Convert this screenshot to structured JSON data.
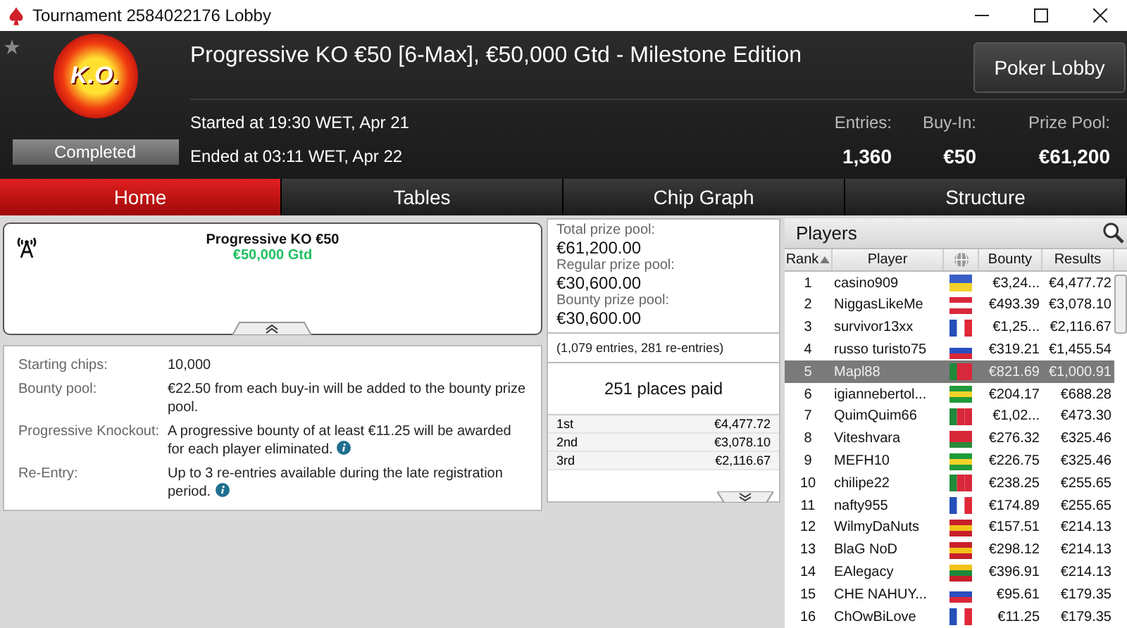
{
  "window": {
    "title": "Tournament 2584022176 Lobby"
  },
  "header": {
    "title": "Progressive KO €50 [6-Max], €50,000 Gtd - Milestone Edition",
    "logo_text": "K.O.",
    "status": "Completed",
    "started": "Started at 19:30 WET, Apr 21",
    "ended": "Ended at 03:11 WET, Apr 22",
    "lobby_button": "Poker Lobby",
    "stats": [
      {
        "label": "Entries:",
        "value": "1,360"
      },
      {
        "label": "Buy-In:",
        "value": "€50"
      },
      {
        "label": "Prize Pool:",
        "value": "€61,200"
      }
    ]
  },
  "tabs": [
    {
      "label": "Home",
      "selected": true
    },
    {
      "label": "Tables",
      "selected": false
    },
    {
      "label": "Chip Graph",
      "selected": false
    },
    {
      "label": "Structure",
      "selected": false
    }
  ],
  "summary": {
    "name": "Progressive KO €50",
    "guarantee": "€50,000 Gtd"
  },
  "details": [
    {
      "label": "Starting chips:",
      "value": "10,000",
      "info": false
    },
    {
      "label": "Bounty pool:",
      "value": "€22.50 from each buy-in will be added to the bounty prize pool.",
      "info": false
    },
    {
      "label": "Progressive Knockout:",
      "value": "A progressive bounty of at least €11.25 will be awarded for each player eliminated.",
      "info": true
    },
    {
      "label": "Re-Entry:",
      "value": "Up to 3 re-entries available during the late registration period.",
      "info": true
    }
  ],
  "prizes": {
    "pools": [
      {
        "label": "Total prize pool:",
        "value": "€61,200.00"
      },
      {
        "label": "Regular prize pool:",
        "value": "€30,600.00"
      },
      {
        "label": "Bounty prize pool:",
        "value": "€30,600.00"
      }
    ],
    "entries_note": "(1,079 entries, 281 re-entries)",
    "places_paid": "251 places paid",
    "payouts": [
      {
        "place": "1st",
        "amount": "€4,477.72"
      },
      {
        "place": "2nd",
        "amount": "€3,078.10"
      },
      {
        "place": "3rd",
        "amount": "€2,116.67"
      }
    ]
  },
  "players": {
    "title": "Players",
    "columns": [
      "Rank",
      "Player",
      "Bounty",
      "Results"
    ],
    "rows": [
      {
        "rank": "1",
        "name": "casino909",
        "bounty": "€3,24...",
        "result": "€4,477.72",
        "selected": false,
        "kind": "h",
        "colors": [
          {
            "color": "#3a5fc8"
          },
          {
            "color": "#f2d22a"
          }
        ]
      },
      {
        "rank": "2",
        "name": "NiggasLikeMe",
        "bounty": "€493.39",
        "result": "€3,078.10",
        "selected": false,
        "kind": "h",
        "colors": [
          {
            "color": "#d8283a"
          },
          {
            "color": "#ffffff"
          },
          {
            "color": "#d8283a"
          }
        ]
      },
      {
        "rank": "3",
        "name": "survivor13xx",
        "bounty": "€1,25...",
        "result": "€2,116.67",
        "selected": false,
        "kind": "v",
        "colors": [
          {
            "color": "#2550b8"
          },
          {
            "color": "#ffffff"
          },
          {
            "color": "#e0283a"
          }
        ]
      },
      {
        "rank": "4",
        "name": "russo turisto75",
        "bounty": "€319.21",
        "result": "€1,455.54",
        "selected": false,
        "kind": "h",
        "colors": [
          {
            "color": "#ffffff"
          },
          {
            "color": "#2a4ec0"
          },
          {
            "color": "#d8283a"
          }
        ]
      },
      {
        "rank": "5",
        "name": "Mapl88",
        "bounty": "€821.69",
        "result": "€1,000.91",
        "selected": true,
        "kind": "v",
        "colors": [
          {
            "color": "#1f8a3a"
          },
          {
            "color": "#d8283a"
          },
          {
            "color": "#d8283a"
          }
        ]
      },
      {
        "rank": "6",
        "name": "igiannebertol...",
        "bounty": "€204.17",
        "result": "€688.28",
        "selected": false,
        "kind": "h",
        "colors": [
          {
            "color": "#1f9a3a"
          },
          {
            "color": "#f2d22a"
          },
          {
            "color": "#1f9a3a"
          }
        ]
      },
      {
        "rank": "7",
        "name": "QuimQuim66",
        "bounty": "€1,02...",
        "result": "€473.30",
        "selected": false,
        "kind": "v",
        "colors": [
          {
            "color": "#1f8a3a"
          },
          {
            "color": "#d8283a"
          },
          {
            "color": "#d8283a"
          }
        ]
      },
      {
        "rank": "8",
        "name": "Viteshvara",
        "bounty": "€276.32",
        "result": "€325.46",
        "selected": false,
        "kind": "h",
        "colors": [
          {
            "color": "#d8283a"
          },
          {
            "color": "#d8283a"
          },
          {
            "color": "#2a8a3a"
          }
        ]
      },
      {
        "rank": "9",
        "name": "MEFH10",
        "bounty": "€226.75",
        "result": "€325.46",
        "selected": false,
        "kind": "h",
        "colors": [
          {
            "color": "#1f9a3a"
          },
          {
            "color": "#f2d22a"
          },
          {
            "color": "#1f9a3a"
          }
        ]
      },
      {
        "rank": "10",
        "name": "chilipe22",
        "bounty": "€238.25",
        "result": "€255.65",
        "selected": false,
        "kind": "v",
        "colors": [
          {
            "color": "#1f8a3a"
          },
          {
            "color": "#d8283a"
          },
          {
            "color": "#d8283a"
          }
        ]
      },
      {
        "rank": "11",
        "name": "nafty955",
        "bounty": "€174.89",
        "result": "€255.65",
        "selected": false,
        "kind": "v",
        "colors": [
          {
            "color": "#2550b8"
          },
          {
            "color": "#ffffff"
          },
          {
            "color": "#e0283a"
          }
        ]
      },
      {
        "rank": "12",
        "name": "WilmyDaNuts",
        "bounty": "€157.51",
        "result": "€214.13",
        "selected": false,
        "kind": "h",
        "colors": [
          {
            "color": "#c8202a"
          },
          {
            "color": "#f2c21a"
          },
          {
            "color": "#c8202a"
          }
        ]
      },
      {
        "rank": "13",
        "name": "BlaG NoD",
        "bounty": "€298.12",
        "result": "€214.13",
        "selected": false,
        "kind": "h",
        "colors": [
          {
            "color": "#c8202a"
          },
          {
            "color": "#f2c21a"
          },
          {
            "color": "#c8202a"
          }
        ]
      },
      {
        "rank": "14",
        "name": "EAlegacy",
        "bounty": "€396.91",
        "result": "€214.13",
        "selected": false,
        "kind": "h",
        "colors": [
          {
            "color": "#f2c21a"
          },
          {
            "color": "#1f8a3a"
          },
          {
            "color": "#c8202a"
          }
        ]
      },
      {
        "rank": "15",
        "name": "CHE NAHUY...",
        "bounty": "€95.61",
        "result": "€179.35",
        "selected": false,
        "kind": "h",
        "colors": [
          {
            "color": "#ffffff"
          },
          {
            "color": "#2a4ec0"
          },
          {
            "color": "#d8283a"
          }
        ]
      },
      {
        "rank": "16",
        "name": "ChOwBiLove",
        "bounty": "€11.25",
        "result": "€179.35",
        "selected": false,
        "kind": "v",
        "colors": [
          {
            "color": "#2550b8"
          },
          {
            "color": "#ffffff"
          },
          {
            "color": "#e0283a"
          }
        ]
      }
    ]
  }
}
